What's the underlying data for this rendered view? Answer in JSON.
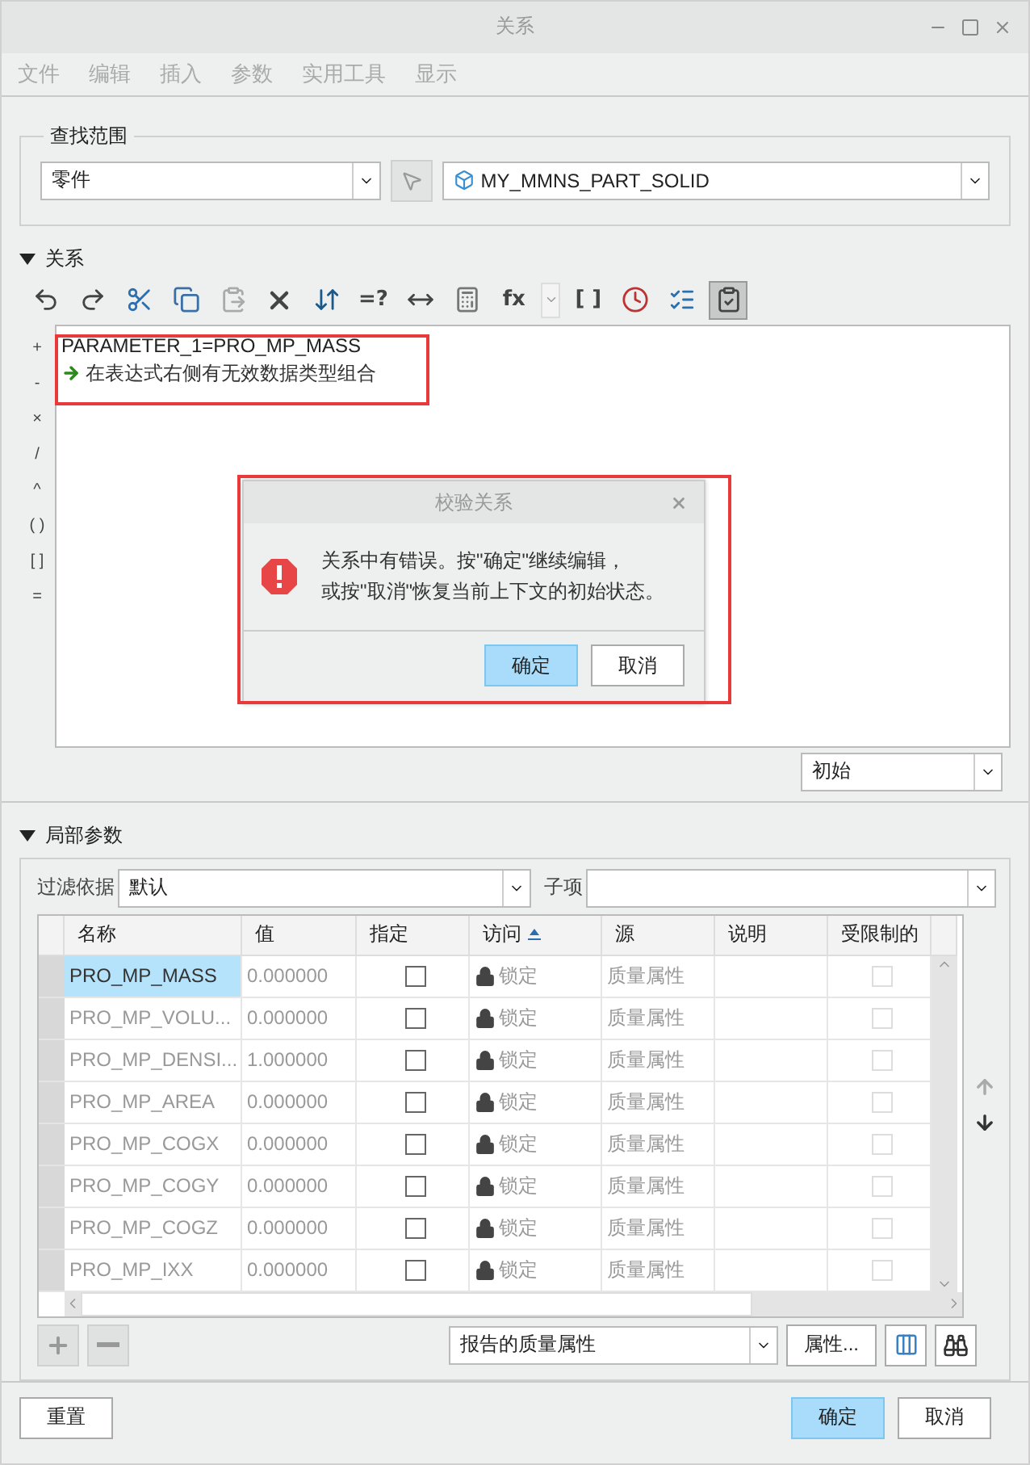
{
  "window": {
    "title": "关系"
  },
  "menu": [
    "文件",
    "编辑",
    "插入",
    "参数",
    "实用工具",
    "显示"
  ],
  "lookup": {
    "legend": "查找范围",
    "scope": "零件",
    "model": "MY_MMNS_PART_SOLID"
  },
  "relations": {
    "heading": "关系",
    "expanded": true,
    "toolbar": [
      {
        "kind": "undo",
        "pressed": false
      },
      {
        "kind": "redo",
        "pressed": false
      },
      {
        "kind": "cut",
        "pressed": false
      },
      {
        "kind": "copy",
        "pressed": false
      },
      {
        "kind": "paste",
        "pressed": false
      },
      {
        "kind": "delete",
        "pressed": false
      },
      {
        "kind": "sort",
        "pressed": false
      },
      {
        "kind": "text",
        "label": "=?",
        "pressed": false
      },
      {
        "kind": "dimension",
        "pressed": false
      },
      {
        "kind": "evaluate",
        "pressed": false
      },
      {
        "kind": "text",
        "label": "fx",
        "pressed": false
      },
      {
        "kind": "caret",
        "pressed": false
      },
      {
        "kind": "text",
        "label": "[ ]",
        "pressed": false
      },
      {
        "kind": "timer",
        "pressed": false
      },
      {
        "kind": "list",
        "pressed": false
      },
      {
        "kind": "verify",
        "pressed": true
      }
    ],
    "operators": [
      "+",
      "-",
      "×",
      "/",
      "^",
      "( )",
      "[ ]",
      "="
    ],
    "lines": [
      {
        "kind": "code",
        "text": "PARAMETER_1=PRO_MP_MASS"
      },
      {
        "kind": "error",
        "text": "在表达式右侧有无效数据类型组合"
      }
    ],
    "mode": "初始"
  },
  "dialog": {
    "title": "校验关系",
    "message_lines": [
      "关系中有错误。按\"确定\"继续编辑，",
      "或按\"取消\"恢复当前上下文的初始状态。"
    ],
    "buttons": [
      {
        "label": "确定",
        "default": true
      },
      {
        "label": "取消",
        "default": false
      }
    ]
  },
  "local_params": {
    "heading": "局部参数",
    "expanded": true,
    "filter_label": "过滤依据",
    "filter": "默认",
    "child_label": "子项",
    "columns": [
      {
        "label": "名称",
        "sorted": false
      },
      {
        "label": "值",
        "sorted": false
      },
      {
        "label": "指定",
        "sorted": false
      },
      {
        "label": "访问",
        "sorted": true
      },
      {
        "label": "源",
        "sorted": false
      },
      {
        "label": "说明",
        "sorted": false
      },
      {
        "label": "受限制的",
        "sorted": false
      }
    ],
    "rows": [
      {
        "name": "PRO_MP_MASS",
        "value": "0.000000",
        "assigned": false,
        "access": "锁定",
        "source": "质量属性",
        "restricted": false,
        "selected": true
      },
      {
        "name": "PRO_MP_VOLU...",
        "value": "0.000000",
        "assigned": false,
        "access": "锁定",
        "source": "质量属性",
        "restricted": false,
        "selected": false
      },
      {
        "name": "PRO_MP_DENSI...",
        "value": "1.000000",
        "assigned": false,
        "access": "锁定",
        "source": "质量属性",
        "restricted": false,
        "selected": false
      },
      {
        "name": "PRO_MP_AREA",
        "value": "0.000000",
        "assigned": false,
        "access": "锁定",
        "source": "质量属性",
        "restricted": false,
        "selected": false
      },
      {
        "name": "PRO_MP_COGX",
        "value": "0.000000",
        "assigned": false,
        "access": "锁定",
        "source": "质量属性",
        "restricted": false,
        "selected": false
      },
      {
        "name": "PRO_MP_COGY",
        "value": "0.000000",
        "assigned": false,
        "access": "锁定",
        "source": "质量属性",
        "restricted": false,
        "selected": false
      },
      {
        "name": "PRO_MP_COGZ",
        "value": "0.000000",
        "assigned": false,
        "access": "锁定",
        "source": "质量属性",
        "restricted": false,
        "selected": false
      },
      {
        "name": "PRO_MP_IXX",
        "value": "0.000000",
        "assigned": false,
        "access": "锁定",
        "source": "质量属性",
        "restricted": false,
        "selected": false
      }
    ],
    "view": "报告的质量属性",
    "properties_button": "属性..."
  },
  "footer": {
    "reset": "重置",
    "ok": "确定",
    "cancel": "取消"
  }
}
